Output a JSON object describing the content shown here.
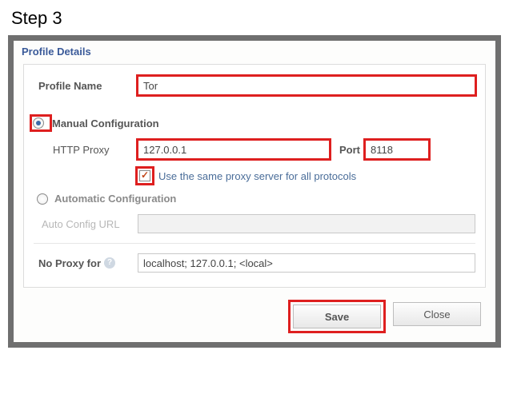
{
  "step_label": "Step 3",
  "section_title": "Profile Details",
  "profile_name": {
    "label": "Profile Name",
    "value": "Tor"
  },
  "manual": {
    "label": "Manual Configuration",
    "checked": true,
    "http_proxy": {
      "label": "HTTP Proxy",
      "value": "127.0.0.1"
    },
    "port": {
      "label": "Port",
      "value": "8118"
    },
    "same_proxy": {
      "label": "Use the same proxy server for all protocols",
      "checked": true
    }
  },
  "automatic": {
    "label": "Automatic Configuration",
    "checked": false,
    "auto_url": {
      "label": "Auto Config URL",
      "value": ""
    }
  },
  "no_proxy": {
    "label": "No Proxy for",
    "value": "localhost; 127.0.0.1; <local>"
  },
  "buttons": {
    "save": "Save",
    "close": "Close"
  },
  "colors": {
    "highlight": "#de1f1f",
    "frame": "#6f6f6f",
    "title": "#3a5a99"
  }
}
